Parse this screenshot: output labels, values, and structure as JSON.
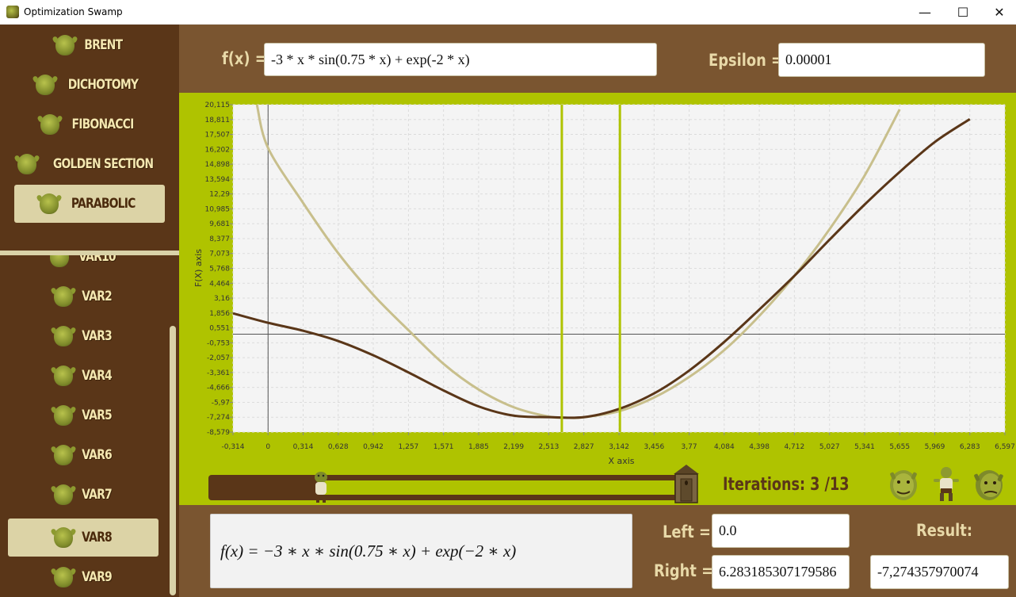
{
  "window": {
    "title": "Optimization Swamp",
    "controls": {
      "minimize": "—",
      "maximize": "☐",
      "close": "✕"
    }
  },
  "sidebar": {
    "methods": [
      {
        "label": "BRENT",
        "active": false
      },
      {
        "label": "DICHOTOMY",
        "active": false
      },
      {
        "label": "FIBONACCI",
        "active": false
      },
      {
        "label": "GOLDEN SECTION",
        "active": false
      },
      {
        "label": "PARABOLIC",
        "active": true
      }
    ],
    "variants": [
      {
        "label": "VAR10",
        "active": false
      },
      {
        "label": "VAR2",
        "active": false
      },
      {
        "label": "VAR3",
        "active": false
      },
      {
        "label": "VAR4",
        "active": false
      },
      {
        "label": "VAR5",
        "active": false
      },
      {
        "label": "VAR6",
        "active": false
      },
      {
        "label": "VAR7",
        "active": false
      },
      {
        "label": "VAR8",
        "active": true
      },
      {
        "label": "VAR9",
        "active": false
      }
    ]
  },
  "header": {
    "function_label": "f(x) =",
    "function_value": "-3 * x * sin(0.75 * x) + exp(-2 * x)",
    "epsilon_label": "Epsilon =",
    "epsilon_value": "0.00001"
  },
  "chart_data": {
    "type": "line",
    "xlabel": "X axis",
    "ylabel": "F(X) axis",
    "xlim": [
      -0.314,
      6.597
    ],
    "ylim": [
      -8.579,
      20.115
    ],
    "x_ticks": [
      "-0,314",
      "0",
      "0,314",
      "0,628",
      "0,942",
      "1,257",
      "1,571",
      "1,885",
      "2,199",
      "2,513",
      "2,827",
      "3,142",
      "3,456",
      "3,77",
      "4,084",
      "4,398",
      "4,712",
      "5,027",
      "5,341",
      "5,655",
      "5,969",
      "6,283",
      "6,597"
    ],
    "y_ticks": [
      "20,115",
      "18,811",
      "17,507",
      "16,202",
      "14,898",
      "13,594",
      "12,29",
      "10,985",
      "9,681",
      "8,377",
      "7,073",
      "5,768",
      "4,464",
      "3,16",
      "1,856",
      "0,551",
      "-0,753",
      "-2,057",
      "-3,361",
      "-4,666",
      "-5,97",
      "-7,274",
      "-8,579"
    ],
    "grid": true,
    "series": [
      {
        "role": "function",
        "color": "#5a3618",
        "x": [
          -0.314,
          0,
          0.314,
          0.628,
          0.942,
          1.257,
          1.571,
          1.885,
          2.199,
          2.513,
          2.827,
          3.142,
          3.456,
          3.77,
          4.084,
          4.398,
          4.712,
          5.027,
          5.341,
          5.655,
          5.969,
          6.283
        ],
        "y": [
          1.83,
          1.0,
          0.3,
          -0.6,
          -1.85,
          -3.35,
          -4.93,
          -6.33,
          -7.14,
          -7.27,
          -7.27,
          -6.55,
          -5.19,
          -3.19,
          -0.68,
          2.16,
          5.11,
          8.28,
          11.36,
          14.22,
          16.84,
          18.85
        ]
      },
      {
        "role": "parabola",
        "color": "#c8bf8c",
        "x": [
          -0.1,
          0,
          0.314,
          0.628,
          0.942,
          1.257,
          1.571,
          1.885,
          2.199,
          2.513,
          2.69,
          2.827,
          3.142,
          3.456,
          3.77,
          4.084,
          4.398,
          4.712,
          5.027,
          5.341,
          5.655
        ],
        "y": [
          20.115,
          16.32,
          11.5,
          7.1,
          3.45,
          0.35,
          -2.6,
          -4.85,
          -6.4,
          -7.22,
          -7.33,
          -7.28,
          -6.75,
          -5.55,
          -3.75,
          -1.4,
          1.6,
          5.1,
          9.2,
          13.9,
          19.7
        ]
      }
    ],
    "bracket_x": [
      2.63,
      3.15
    ],
    "bracket_color": "#afc300"
  },
  "slider": {
    "iterations_text": "Iterations: 3 /13",
    "current": 3,
    "total": 13
  },
  "bottom": {
    "formula_display": "f(x) = −3 ∗ x ∗ sin(0.75 ∗ x) + exp(−2 ∗ x)",
    "left_label": "Left =",
    "left_value": "0.0",
    "right_label": "Right =",
    "right_value": "6.283185307179586",
    "result_label": "Result:",
    "result_value": "-7,274357970074"
  }
}
